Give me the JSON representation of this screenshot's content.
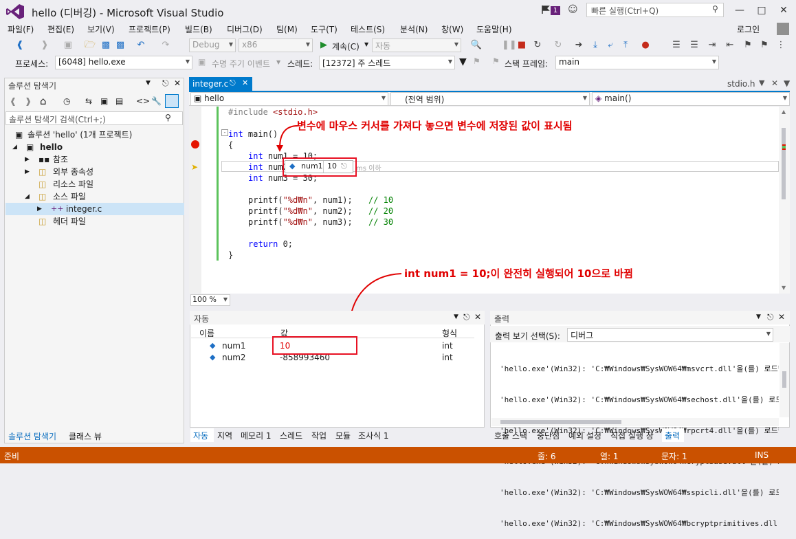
{
  "window": {
    "title": "hello (디버깅) - Microsoft Visual Studio",
    "notify_count": "1",
    "quick_launch_placeholder": "빠른 실행(Ctrl+Q)",
    "login": "로그인"
  },
  "menu": [
    "파일(F)",
    "편집(E)",
    "보기(V)",
    "프로젝트(P)",
    "빌드(B)",
    "디버그(D)",
    "팀(M)",
    "도구(T)",
    "테스트(S)",
    "분석(N)",
    "창(W)",
    "도움말(H)"
  ],
  "toolbar": {
    "config": "Debug",
    "platform": "x86",
    "continue_label": "계속(C)",
    "auto_label": "자동"
  },
  "debug_location": {
    "process_label": "프로세스:",
    "process_value": "[6048] hello.exe",
    "lifecycle_label": "수명 주기 이벤트",
    "thread_label": "스레드:",
    "thread_value": "[12372] 주 스레드",
    "stack_label": "스택 프레임:",
    "stack_value": "main"
  },
  "solution_explorer": {
    "title": "솔루션 탐색기",
    "search_placeholder": "솔루션 탐색기 검색(Ctrl+;)",
    "solution_label": "솔루션 'hello' (1개 프로젝트)",
    "project": "hello",
    "items": [
      "참조",
      "외부 종속성",
      "리소스 파일",
      "소스 파일",
      "integer.c",
      "헤더 파일"
    ],
    "tabs": [
      "솔루션 탐색기",
      "클래스 뷰"
    ]
  },
  "editor": {
    "active_tab": "integer.c",
    "other_tab": "stdio.h",
    "nav_project": "hello",
    "nav_scope": "(전역 범위)",
    "nav_function": "main()",
    "zoom": "100 %",
    "lines": {
      "l1_pp": "#include ",
      "l1_str": "<stdio.h>",
      "l3_kw": "int",
      "l3_rest": " main()",
      "l4": "{",
      "l5_kw": "int",
      "l5_rest": " num1 = 10;",
      "l6_kw": "int",
      "l6_rest": " num2",
      "l7_kw": "int",
      "l7_rest": " num3 = 30;",
      "l9_a": "printf(",
      "l9_str": "\"%d₩n\"",
      "l9_b": ", num1);",
      "l9_cm": "// 10",
      "l10_a": "printf(",
      "l10_str": "\"%d₩n\"",
      "l10_b": ", num2);",
      "l10_cm": "// 20",
      "l11_a": "printf(",
      "l11_str": "\"%d₩n\"",
      "l11_b": ", num3);",
      "l11_cm": "// 30",
      "l13_kw": "return",
      "l13_rest": " 0;",
      "l14": "}"
    },
    "datatip_name": "num1",
    "datatip_value": "10",
    "perf_tip": "ms 이하",
    "annotation_top": "변수에 마우스 커서를 가져다 놓으면 변수에 저장된 값이 표시됨",
    "annotation_mid": "int num1 = 10;이 완전히 실행되어 10으로 바뀜"
  },
  "autos": {
    "title": "자동",
    "col_name": "이름",
    "col_value": "값",
    "col_type": "형식",
    "rows": [
      {
        "name": "num1",
        "value": "10",
        "type": "int"
      },
      {
        "name": "num2",
        "value": "-858993460",
        "type": "int"
      }
    ],
    "tabs": [
      "자동",
      "지역",
      "메모리 1",
      "스레드",
      "작업",
      "모듈",
      "조사식 1"
    ]
  },
  "output": {
    "title": "출력",
    "source_label": "출력 보기 선택(S):",
    "source_value": "디버그",
    "lines": [
      "'hello.exe'(Win32): 'C:₩Windows₩SysWOW64₩msvcrt.dll'을(를) 로드했습니",
      "'hello.exe'(Win32): 'C:₩Windows₩SysWOW64₩sechost.dll'을(를) 로드했습",
      "'hello.exe'(Win32): 'C:₩Windows₩SysWOW64₩rpcrt4.dll'을(를) 로드했습니",
      "'hello.exe'(Win32): 'C:₩Windows₩SysWOW64₩cryptbase.dll'을(를) 로드했",
      "'hello.exe'(Win32): 'C:₩Windows₩SysWOW64₩sspicli.dll'을(를) 로드했습",
      "'hello.exe'(Win32): 'C:₩Windows₩SysWOW64₩bcryptprimitives.dll'을(를)"
    ],
    "tabs": [
      "호출 스택",
      "중단점",
      "예외 설정",
      "직접 실행 창",
      "출력"
    ]
  },
  "status": {
    "ready": "준비",
    "line": "줄: 6",
    "col": "열: 1",
    "char": "문자: 1",
    "ins": "INS"
  },
  "colors": {
    "accent": "#007acc",
    "status_bar": "#ca5100",
    "annotation": "#e00000",
    "vs_purple": "#68217a"
  }
}
